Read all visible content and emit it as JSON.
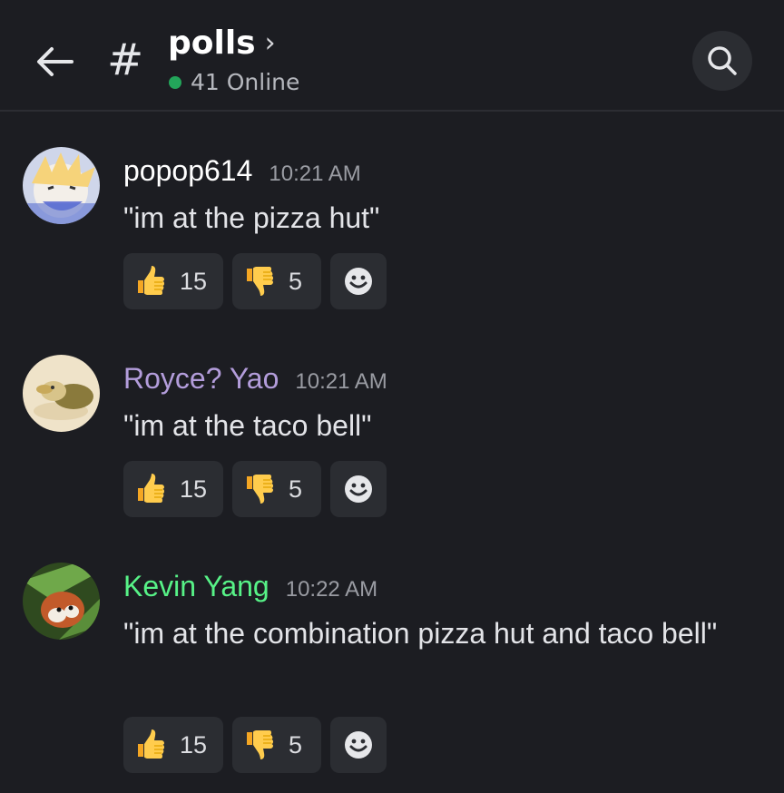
{
  "header": {
    "back_icon": "arrow-left-icon",
    "channel_icon": "hash-icon",
    "channel_hash": "#",
    "channel_name": "polls",
    "chevron": "›",
    "online_text": "41 Online",
    "online_color": "#23a55a",
    "search_icon": "search-icon"
  },
  "messages": [
    {
      "username": "popop614",
      "username_color": "#ffffff",
      "time": "10:21 AM",
      "text": "\"im at the pizza hut\"",
      "reactions": [
        {
          "emoji": "thumbs-up",
          "count": "15"
        },
        {
          "emoji": "thumbs-down",
          "count": "5"
        },
        {
          "emoji": "add-reaction-smiley"
        }
      ]
    },
    {
      "username": "Royce? Yao",
      "username_color": "#b39ddb",
      "time": "10:21 AM",
      "text": "\"im at the taco bell\"",
      "reactions": [
        {
          "emoji": "thumbs-up",
          "count": "15"
        },
        {
          "emoji": "thumbs-down",
          "count": "5"
        },
        {
          "emoji": "add-reaction-smiley"
        }
      ]
    },
    {
      "username": "Kevin Yang",
      "username_color": "#57f287",
      "time": "10:22 AM",
      "text": "\"im at the combination pizza hut and taco bell\"",
      "reactions": [
        {
          "emoji": "thumbs-up",
          "count": "15"
        },
        {
          "emoji": "thumbs-down",
          "count": "5"
        },
        {
          "emoji": "add-reaction-smiley"
        }
      ]
    }
  ]
}
